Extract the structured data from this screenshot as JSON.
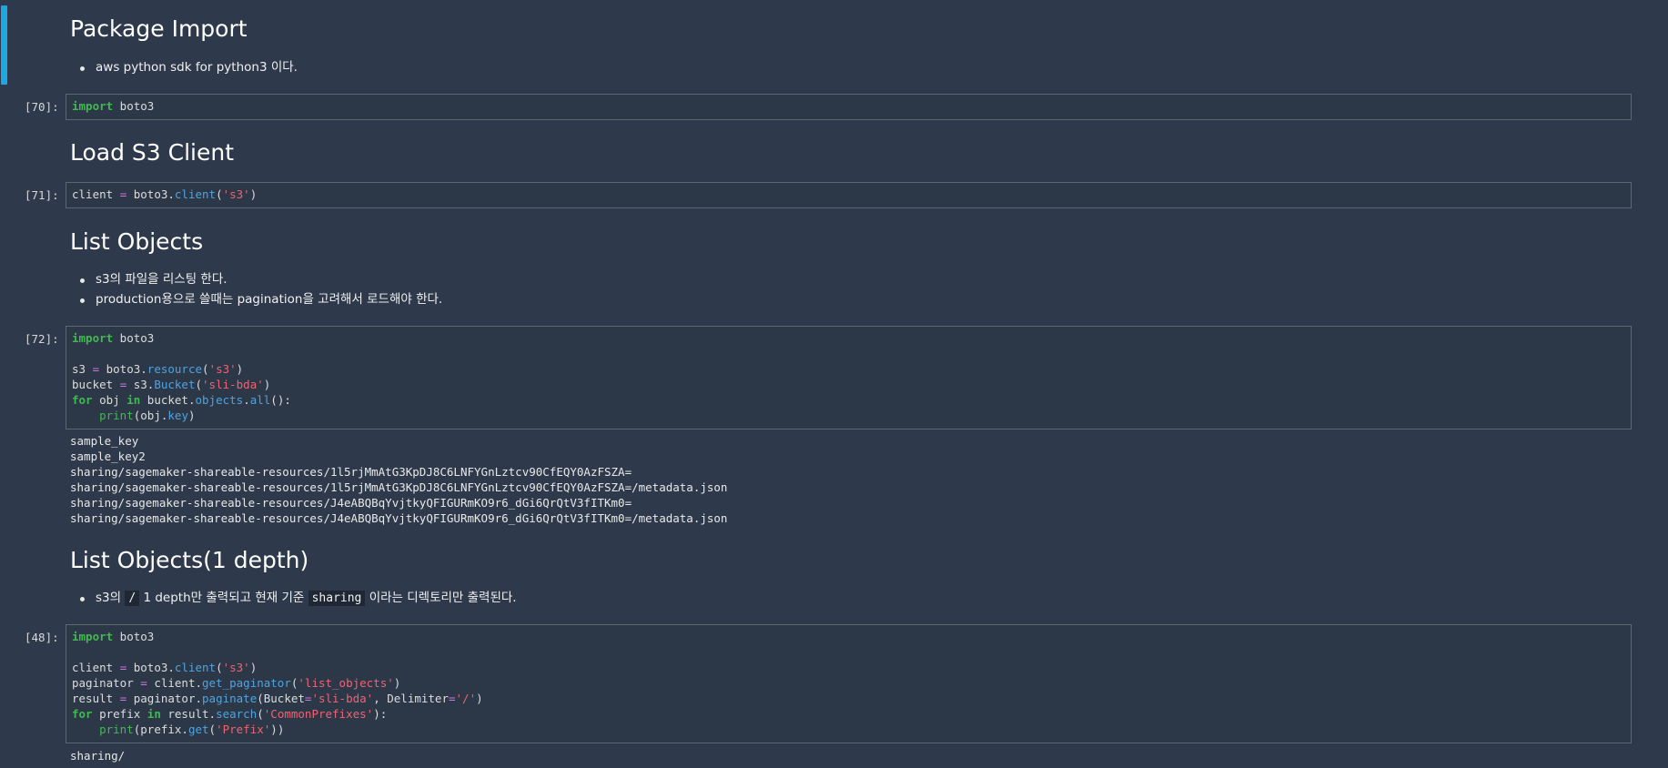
{
  "sections": {
    "package_import": {
      "heading": "Package Import",
      "bullets": [
        "aws python sdk for python3 이다."
      ]
    },
    "load_s3_client": {
      "heading": "Load S3 Client"
    },
    "list_objects": {
      "heading": "List Objects",
      "bullets": [
        "s3의 파일을 리스팅 한다.",
        "production용으로 쓸때는 pagination을 고려해서 로드해야 한다."
      ]
    },
    "list_objects_depth": {
      "heading": "List Objects(1 depth)",
      "bullet_parts": [
        "s3의",
        "/",
        "1 depth만 출력되고 현재 기준",
        "sharing",
        "이라는 디렉토리만 출력된다."
      ]
    }
  },
  "cells": [
    {
      "prompt": "[70]:",
      "code": {
        "import_kw": "import",
        "module": " boto3"
      }
    },
    {
      "prompt": "[71]:",
      "code": {
        "var": "client ",
        "eq": "=",
        "obj": " boto3.",
        "call": "client",
        "open": "(",
        "arg": "'s3'",
        "close": ")"
      }
    },
    {
      "prompt": "[72]:",
      "code": {
        "l1_kw": "import",
        "l1_mod": " boto3",
        "l3_var": "s3 ",
        "l3_eq": "=",
        "l3_obj": " boto3.",
        "l3_call": "resource",
        "l3_open": "(",
        "l3_arg": "'s3'",
        "l3_close": ")",
        "l4_var": "bucket ",
        "l4_eq": "=",
        "l4_obj": " s3.",
        "l4_call": "Bucket",
        "l4_open": "(",
        "l4_arg": "'sli-bda'",
        "l4_close": ")",
        "l5_for": "for",
        "l5_var": " obj ",
        "l5_in": "in",
        "l5_obj": " bucket.",
        "l5_attr": "objects",
        "l5_dot": ".",
        "l5_call": "all",
        "l5_rest": "():",
        "l6_indent": "    ",
        "l6_print": "print",
        "l6_open": "(obj.",
        "l6_attr": "key",
        "l6_close": ")"
      },
      "output": [
        "sample_key",
        "sample_key2",
        "sharing/sagemaker-shareable-resources/1l5rjMmAtG3KpDJ8C6LNFYGnLztcv90CfEQY0AzFSZA=",
        "sharing/sagemaker-shareable-resources/1l5rjMmAtG3KpDJ8C6LNFYGnLztcv90CfEQY0AzFSZA=/metadata.json",
        "sharing/sagemaker-shareable-resources/J4eABQBqYvjtkyQFIGURmKO9r6_dGi6QrQtV3fITKm0=",
        "sharing/sagemaker-shareable-resources/J4eABQBqYvjtkyQFIGURmKO9r6_dGi6QrQtV3fITKm0=/metadata.json"
      ]
    },
    {
      "prompt": "[48]:",
      "code": {
        "l1_kw": "import",
        "l1_mod": " boto3",
        "l3_var": "client ",
        "l3_eq": "=",
        "l3_obj": " boto3.",
        "l3_call": "client",
        "l3_open": "(",
        "l3_arg": "'s3'",
        "l3_close": ")",
        "l4_var": "paginator ",
        "l4_eq": "=",
        "l4_obj": " client.",
        "l4_call": "get_paginator",
        "l4_open": "(",
        "l4_arg": "'list_objects'",
        "l4_close": ")",
        "l5_var": "result ",
        "l5_eq": "=",
        "l5_obj": " paginator.",
        "l5_call": "paginate",
        "l5_open": "(Bucket",
        "l5_eq2": "=",
        "l5_arg1": "'sli-bda'",
        "l5_mid": ", Delimiter",
        "l5_eq3": "=",
        "l5_arg2": "'/'",
        "l5_close": ")",
        "l6_for": "for",
        "l6_var": " prefix ",
        "l6_in": "in",
        "l6_obj": " result.",
        "l6_call": "search",
        "l6_open": "(",
        "l6_arg": "'CommonPrefixes'",
        "l6_close": "):",
        "l7_indent": "    ",
        "l7_print": "print",
        "l7_open": "(prefix.",
        "l7_call": "get",
        "l7_paren": "(",
        "l7_arg": "'Prefix'",
        "l7_close": "))"
      },
      "output": [
        "sharing/"
      ]
    }
  ]
}
